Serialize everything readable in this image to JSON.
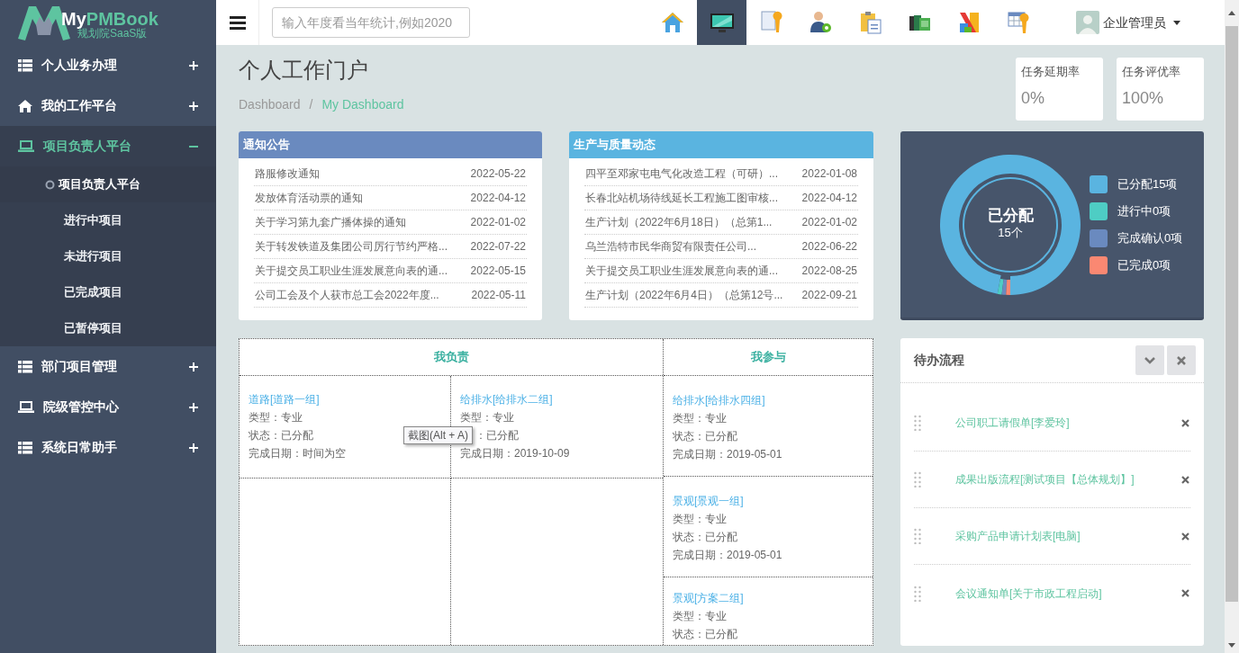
{
  "logo": {
    "prefix": "My",
    "name": "PMBook",
    "subtitle": "规划院SaaS版"
  },
  "sidebar": {
    "items": [
      {
        "kind": "list",
        "label": "个人业务办理",
        "expanded": false,
        "selected": false
      },
      {
        "kind": "home",
        "label": "我的工作平台",
        "expanded": false,
        "selected": false
      },
      {
        "kind": "laptop",
        "label": "项目负责人平台",
        "expanded": true,
        "selected": true,
        "children": [
          {
            "label": "项目负责人平台",
            "selected": true
          },
          {
            "label": "进行中项目",
            "selected": false
          },
          {
            "label": "未进行项目",
            "selected": false
          },
          {
            "label": "已完成项目",
            "selected": false
          },
          {
            "label": "已暂停项目",
            "selected": false
          }
        ]
      },
      {
        "kind": "list",
        "label": "部门项目管理",
        "expanded": false,
        "selected": false
      },
      {
        "kind": "laptop",
        "label": "院级管控中心",
        "expanded": false,
        "selected": false
      },
      {
        "kind": "list",
        "label": "系统日常助手",
        "expanded": false,
        "selected": false
      }
    ]
  },
  "topbar": {
    "search": {
      "placeholder": "输入年度看当年统计,例如2020"
    },
    "toolbar": [
      {
        "kind": "home",
        "selected": false
      },
      {
        "kind": "monitor",
        "selected": true
      },
      {
        "kind": "doc-wrench",
        "selected": false
      },
      {
        "kind": "person-gear",
        "selected": false
      },
      {
        "kind": "clipboard",
        "selected": false
      },
      {
        "kind": "books",
        "selected": false
      },
      {
        "kind": "blocks",
        "selected": false
      },
      {
        "kind": "table-wrench",
        "selected": false
      }
    ],
    "user": {
      "name": "企业管理员"
    }
  },
  "page": {
    "title": "个人工作门户",
    "breadcrumb": {
      "separator": "/",
      "items": [
        {
          "label": "Dashboard",
          "selected": false
        },
        {
          "label": "My Dashboard",
          "selected": true
        }
      ]
    }
  },
  "stats": [
    {
      "label": "任务延期率",
      "value": "0%"
    },
    {
      "label": "任务评优率",
      "value": "100%"
    }
  ],
  "notices": [
    {
      "title": "通知公告",
      "color": "#6a8abf",
      "rows": [
        {
          "text": "路服修改通知",
          "date": "2022-05-22"
        },
        {
          "text": "发放体育活动票的通知",
          "date": "2022-04-12"
        },
        {
          "text": "关于学习第九套广播体操的通知",
          "date": "2022-01-02"
        },
        {
          "text": "关于转发铁道及集团公司厉行节约严格...",
          "date": "2022-07-22"
        },
        {
          "text": "关于提交员工职业生涯发展意向表的通...",
          "date": "2022-05-15"
        },
        {
          "text": "公司工会及个人获市总工会2022年度...",
          "date": "2022-05-11"
        }
      ]
    },
    {
      "title": "生产与质量动态",
      "color": "#5ab4e0",
      "rows": [
        {
          "text": "四平至邓家屯电气化改造工程（可研）...",
          "date": "2022-01-08"
        },
        {
          "text": "长春北站机场待线延长工程施工图审核...",
          "date": "2022-04-12"
        },
        {
          "text": "生产计划（2022年6月18日）（总第1...",
          "date": "2022-01-02"
        },
        {
          "text": "乌兰浩特市民华商贸有限责任公司...",
          "date": "2022-06-22"
        },
        {
          "text": "关于提交员工职业生涯发展意向表的通...",
          "date": "2022-08-25"
        },
        {
          "text": "生产计划（2022年6月4日）（总第12号...",
          "date": "2022-09-21"
        }
      ]
    }
  ],
  "assignment": {
    "center_label": "已分配",
    "center_value": "15个",
    "legend": [
      {
        "label": "已分配15项",
        "color": "#5ab4e0"
      },
      {
        "label": "进行中0项",
        "color": "#4ecdc4"
      },
      {
        "label": "完成确认0项",
        "color": "#6a8abf"
      },
      {
        "label": "已完成0项",
        "color": "#fa8872"
      }
    ]
  },
  "projects": {
    "groups": [
      {
        "title": "我负责",
        "kind": "grid",
        "cards": [
          {
            "title": "道路[道路一组]",
            "lines": [
              "类型：专业",
              "状态：已分配",
              "完成日期：时间为空"
            ]
          },
          {
            "title": "给排水[给排水二组]",
            "lines": [
              "类型：专业",
              "：已分配",
              "完成日期：2019-10-09"
            ],
            "tooltip": "截图(Alt + A)"
          }
        ]
      },
      {
        "title": "我参与",
        "kind": "stack",
        "cards": [
          {
            "title": "给排水[给排水四组]",
            "lines": [
              "类型：专业",
              "状态：已分配",
              "完成日期：2019-05-01"
            ]
          },
          {
            "title": "景观[景观一组]",
            "lines": [
              "类型：专业",
              "状态：已分配",
              "完成日期：2019-05-01"
            ]
          },
          {
            "title": "景观[方案二组]",
            "lines": [
              "类型：专业",
              "状态：已分配"
            ]
          }
        ]
      }
    ]
  },
  "todo": {
    "title": "待办流程",
    "items": [
      {
        "label": "公司职工请假单[李爱玲]"
      },
      {
        "label": "成果出版流程[测试项目【总体规划】]"
      },
      {
        "label": "采购产品申请计划表[电脑]"
      },
      {
        "label": "会议通知单[关于市政工程启动]"
      }
    ]
  }
}
